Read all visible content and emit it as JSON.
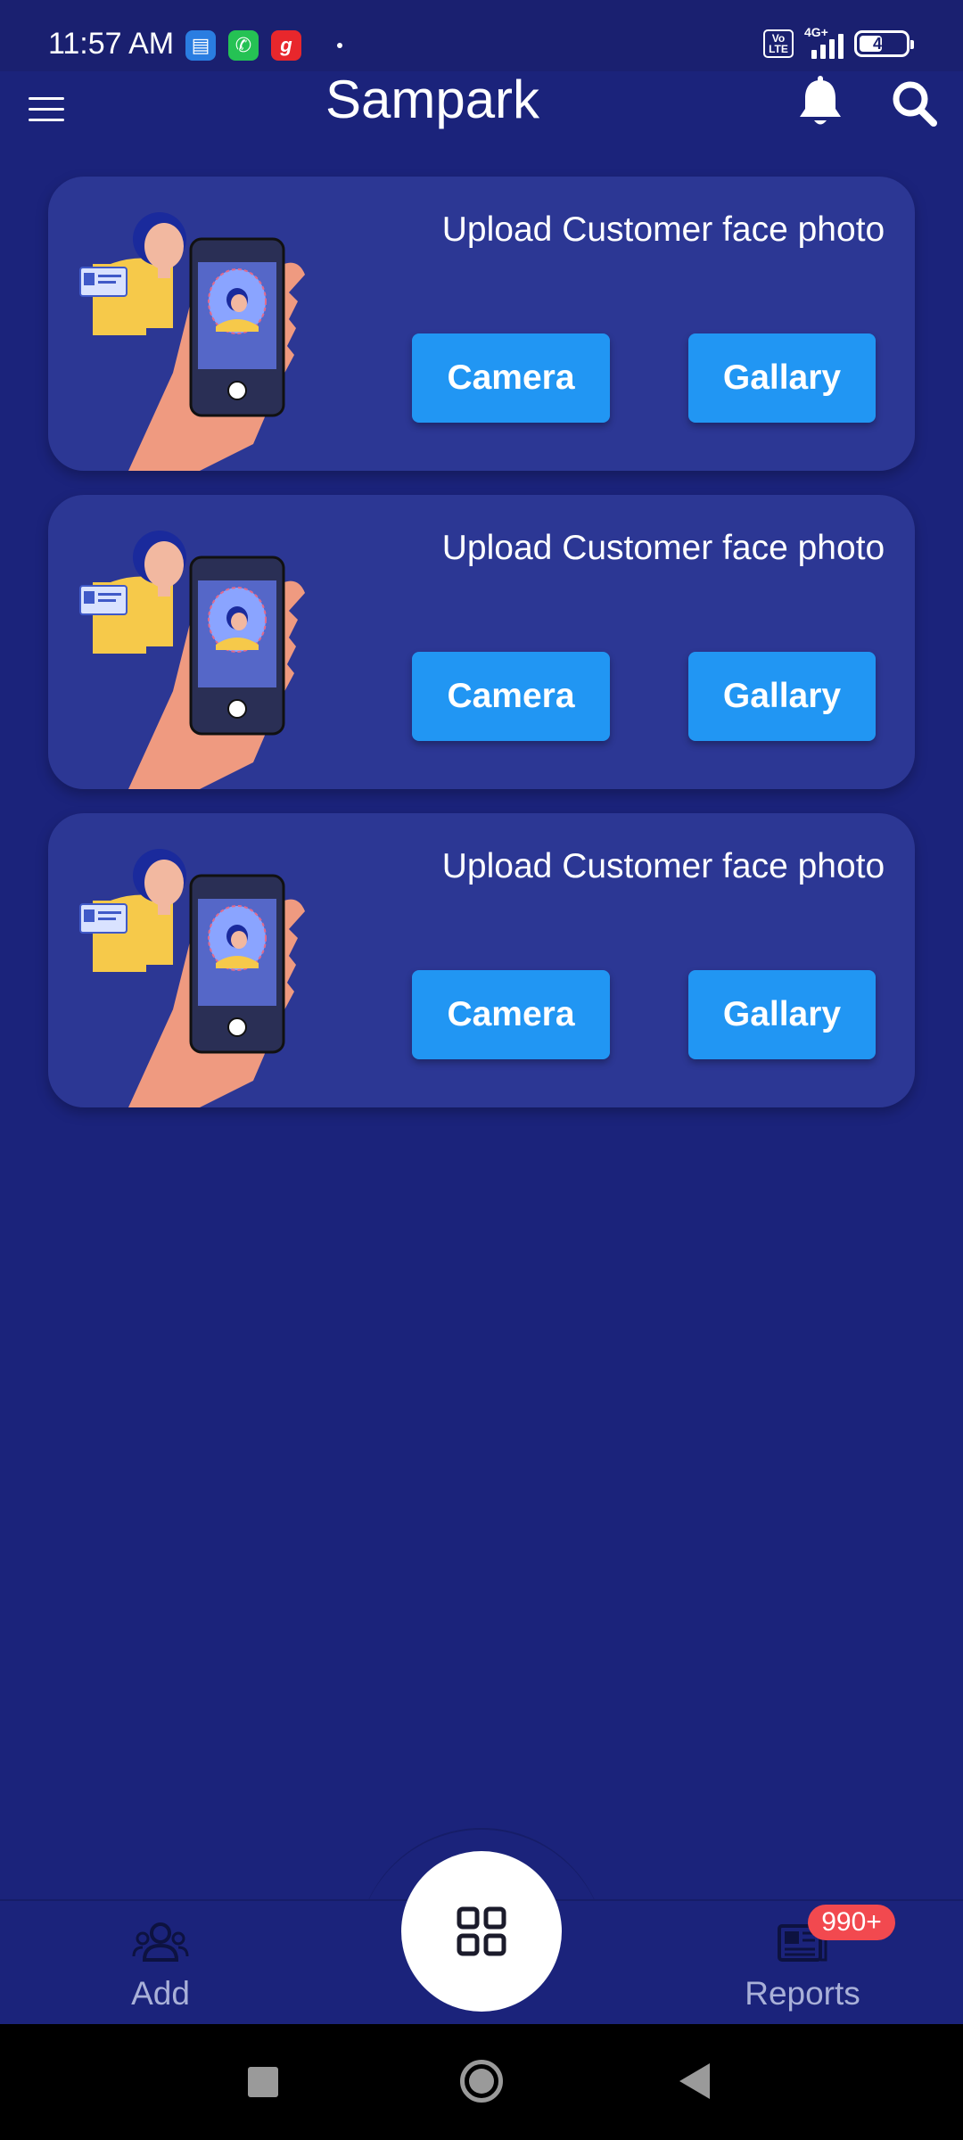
{
  "status_bar": {
    "time": "11:57 AM",
    "network": "4G+",
    "volte": "Vo LTE",
    "battery": "49",
    "battery_level": 0.49
  },
  "app_bar": {
    "title": "Sampark"
  },
  "cards": [
    {
      "title": "Upload Customer face photo",
      "camera_label": "Camera",
      "gallery_label": "Gallary"
    },
    {
      "title": "Upload Customer face photo",
      "camera_label": "Camera",
      "gallery_label": "Gallary"
    },
    {
      "title": "Upload Customer face photo",
      "camera_label": "Camera",
      "gallery_label": "Gallary"
    }
  ],
  "bottom_nav": {
    "add_label": "Add",
    "reports_label": "Reports",
    "reports_badge": "990+"
  },
  "colors": {
    "background": "#1b237b",
    "card": "#2c3794",
    "button": "#2196f3",
    "badge": "#f2494f"
  },
  "icons": {
    "menu": "hamburger-icon",
    "notifications": "bell-icon",
    "search": "search-icon",
    "add": "people-icon",
    "center": "grid-icon",
    "reports": "newspaper-icon"
  }
}
